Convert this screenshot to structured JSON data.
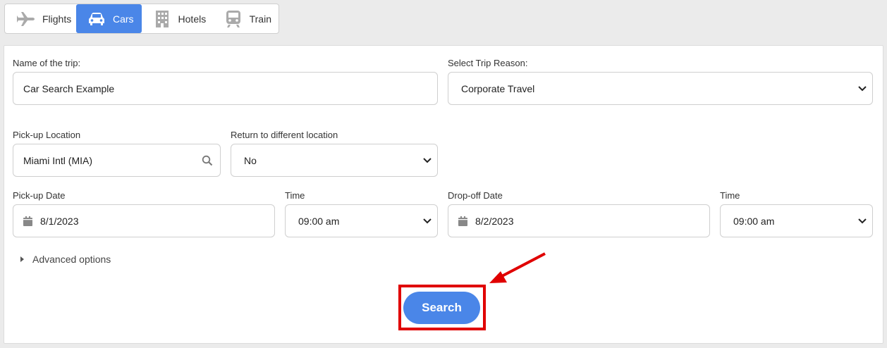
{
  "tabs": [
    {
      "label": "Flights",
      "icon": "plane-icon",
      "active": false
    },
    {
      "label": "Cars",
      "icon": "car-icon",
      "active": true
    },
    {
      "label": "Hotels",
      "icon": "building-icon",
      "active": false
    },
    {
      "label": "Train",
      "icon": "train-icon",
      "active": false
    }
  ],
  "form": {
    "trip_name": {
      "label": "Name of the trip:",
      "value": "Car Search Example"
    },
    "trip_reason": {
      "label": "Select Trip Reason:",
      "value": "Corporate Travel"
    },
    "pickup_location": {
      "label": "Pick-up Location",
      "value": "Miami Intl (MIA)"
    },
    "return_different": {
      "label": "Return to different location",
      "value": "No"
    },
    "pickup_date": {
      "label": "Pick-up Date",
      "value": "8/1/2023"
    },
    "pickup_time": {
      "label": "Time",
      "value": "09:00 am"
    },
    "dropoff_date": {
      "label": "Drop-off Date",
      "value": "8/2/2023"
    },
    "dropoff_time": {
      "label": "Time",
      "value": "09:00 am"
    },
    "advanced_options": "Advanced options",
    "search_label": "Search"
  },
  "colors": {
    "accent": "#4a86e8",
    "highlight": "#e00000"
  }
}
